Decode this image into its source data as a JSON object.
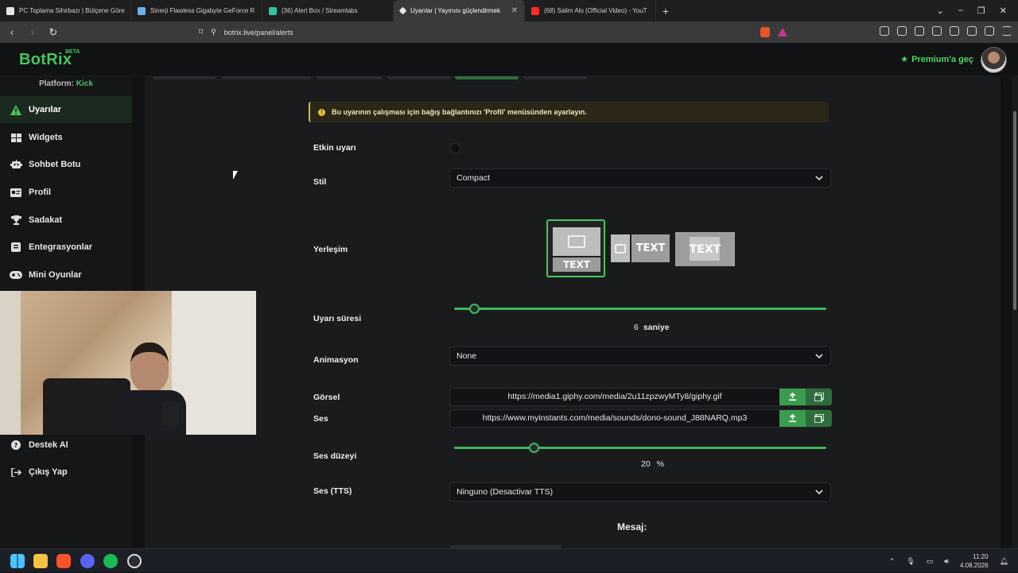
{
  "browser": {
    "tabs": [
      {
        "label": "PC Toplama Sihirbazı | Bütçene Göre",
        "favicon_color": "#e6e6e6"
      },
      {
        "label": "Sinerji Flawless Gigabyte GeForce R",
        "favicon_color": "#6fb0e6"
      },
      {
        "label": "(36) Alert Box / Streamlabs",
        "favicon_color": "#31c3a2"
      },
      {
        "label": "Uyarılar | Yayınını güçlendirmek",
        "favicon_color": "#e6e6e6"
      },
      {
        "label": "(68) Salim Alo (Official Video) - YouT",
        "favicon_color": "#ff2a2a"
      }
    ],
    "active_tab_index": 3,
    "url": "botrix.live/panel/alerts"
  },
  "app": {
    "logo": "BotRix",
    "logo_badge": "BETA",
    "premium_label": "Premium'a geç",
    "platform_label": "Platform:",
    "platform_value": "Kick",
    "accent": "#46c65e"
  },
  "sidebar": {
    "items": [
      {
        "label": "Uyarılar",
        "icon": "warning-icon",
        "active": true
      },
      {
        "label": "Widgets",
        "icon": "grid-icon",
        "active": false
      },
      {
        "label": "Sohbet Botu",
        "icon": "robot-icon",
        "active": false
      },
      {
        "label": "Profil",
        "icon": "id-card-icon",
        "active": false
      },
      {
        "label": "Sadakat",
        "icon": "trophy-icon",
        "active": false
      },
      {
        "label": "Entegrasyonlar",
        "icon": "integration-icon",
        "active": false
      },
      {
        "label": "Mini Oyunlar",
        "icon": "gamepad-icon",
        "active": false
      },
      {
        "label": "Destek Al",
        "icon": "help-icon",
        "active": false
      },
      {
        "label": "Çıkış Yap",
        "icon": "logout-icon",
        "active": false
      }
    ]
  },
  "form": {
    "notice": "Bu uyarının çalışması için bağış bağlantınızı 'Profil' menüsünden ayarlayın.",
    "active_alert_label": "Etkin uyarı",
    "active_alert_on": false,
    "style_label": "Stil",
    "style_value": "Compact",
    "layout_label": "Yerleşim",
    "layout_options": [
      {
        "text": "TEXT",
        "selected": true
      },
      {
        "text": "TEXT",
        "selected": false
      },
      {
        "text": "TEXT",
        "selected": false
      }
    ],
    "duration_label": "Uyarı süresi",
    "duration_value": "6",
    "duration_unit": "saniye",
    "duration_fraction": 0.04,
    "animation_label": "Animasyon",
    "animation_value": "None",
    "image_label": "Görsel",
    "image_url": "https://media1.giphy.com/media/2u11zpzwyMTy8/giphy.gif",
    "sound_label": "Ses",
    "sound_url": "https://www.myinstants.com/media/sounds/dono-sound_J88NARQ.mp3",
    "volume_label": "Ses düzeyi",
    "volume_value": "20",
    "volume_unit": "%",
    "volume_fraction": 0.2,
    "tts_label": "Ses (TTS)",
    "tts_value": "Ninguno (Desactivar TTS)",
    "message_label": "Mesaj:"
  },
  "taskbar": {
    "time": "11:20",
    "date": "4.08.2026"
  }
}
